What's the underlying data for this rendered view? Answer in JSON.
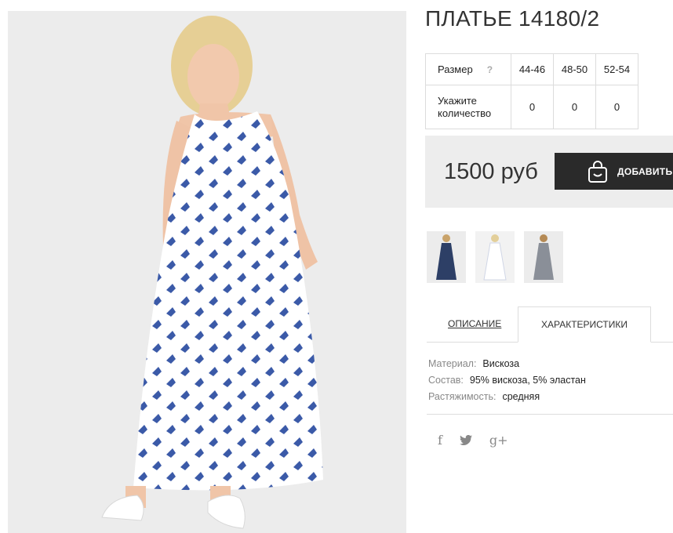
{
  "product": {
    "title": "ПЛАТЬЕ 14180/2",
    "price": "1500 руб",
    "add_label": "ДОБАВИТЬ"
  },
  "sizes_table": {
    "size_label": "Размер",
    "help": "?",
    "qty_label_line1": "Укажите",
    "qty_label_line2": "количество",
    "sizes": [
      "44-46",
      "48-50",
      "52-54"
    ],
    "quantities": [
      "0",
      "0",
      "0"
    ]
  },
  "thumbnails": [
    {
      "icon": "dark-dress-thumb"
    },
    {
      "icon": "white-dress-thumb"
    },
    {
      "icon": "grey-dress-thumb"
    }
  ],
  "tabs": {
    "description": "ОПИСАНИЕ",
    "characteristics": "ХАРАКТЕРИСТИКИ"
  },
  "properties": [
    {
      "key": "Материал:",
      "value": "Вискоза"
    },
    {
      "key": "Состав:",
      "value": "95% вискоза, 5% эластан"
    },
    {
      "key": "Растяжимость:",
      "value": "средняя"
    }
  ],
  "social": {
    "facebook": "f",
    "twitter": "twitter-bird",
    "googleplus": "g+"
  },
  "colors": {
    "button_bg": "#2a2a2a",
    "buybox_bg": "#ededed",
    "print_blue": "#3b5aa8"
  }
}
